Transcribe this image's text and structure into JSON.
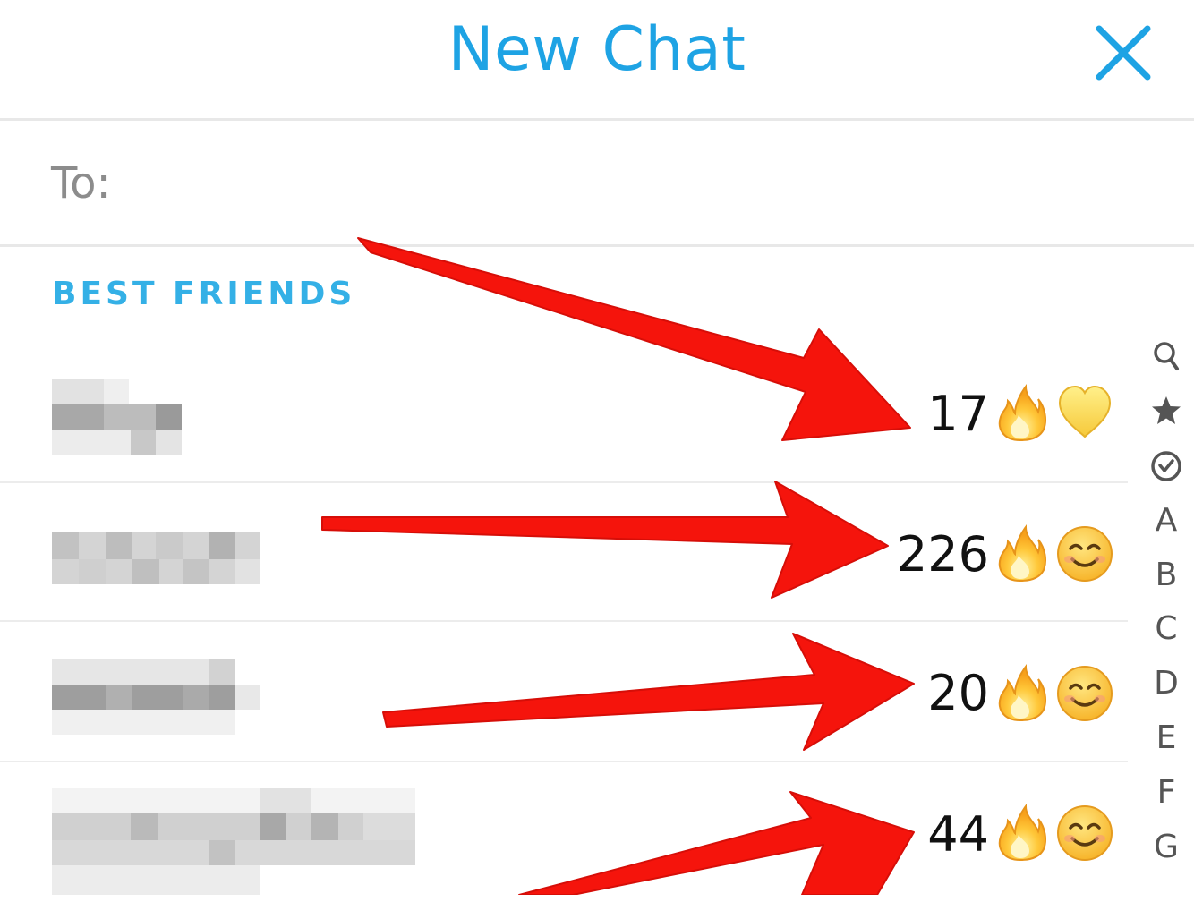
{
  "header": {
    "title": "New Chat",
    "close_icon": "close-icon",
    "accent_color": "#1ea3e4"
  },
  "to_field": {
    "label": "To:",
    "value": ""
  },
  "best_friends": {
    "title": "BEST FRIENDS",
    "items": [
      {
        "name": "",
        "streak": "17",
        "streak_icon": "fire-emoji-icon",
        "friend_icon": "yellow-heart-emoji-icon"
      },
      {
        "name": "",
        "streak": "226",
        "streak_icon": "fire-emoji-icon",
        "friend_icon": "smiling-face-emoji-icon"
      },
      {
        "name": "",
        "streak": "20",
        "streak_icon": "fire-emoji-icon",
        "friend_icon": "smiling-face-emoji-icon"
      },
      {
        "name": "",
        "streak": "44",
        "streak_icon": "fire-emoji-icon",
        "friend_icon": "smiling-face-emoji-icon"
      }
    ]
  },
  "index_bar": {
    "icons": [
      "search-icon",
      "star-icon",
      "check-circle-icon"
    ],
    "letters": [
      "A",
      "B",
      "C",
      "D",
      "E",
      "F",
      "G"
    ]
  },
  "annotation": {
    "arrow_color": "#f5140c"
  }
}
